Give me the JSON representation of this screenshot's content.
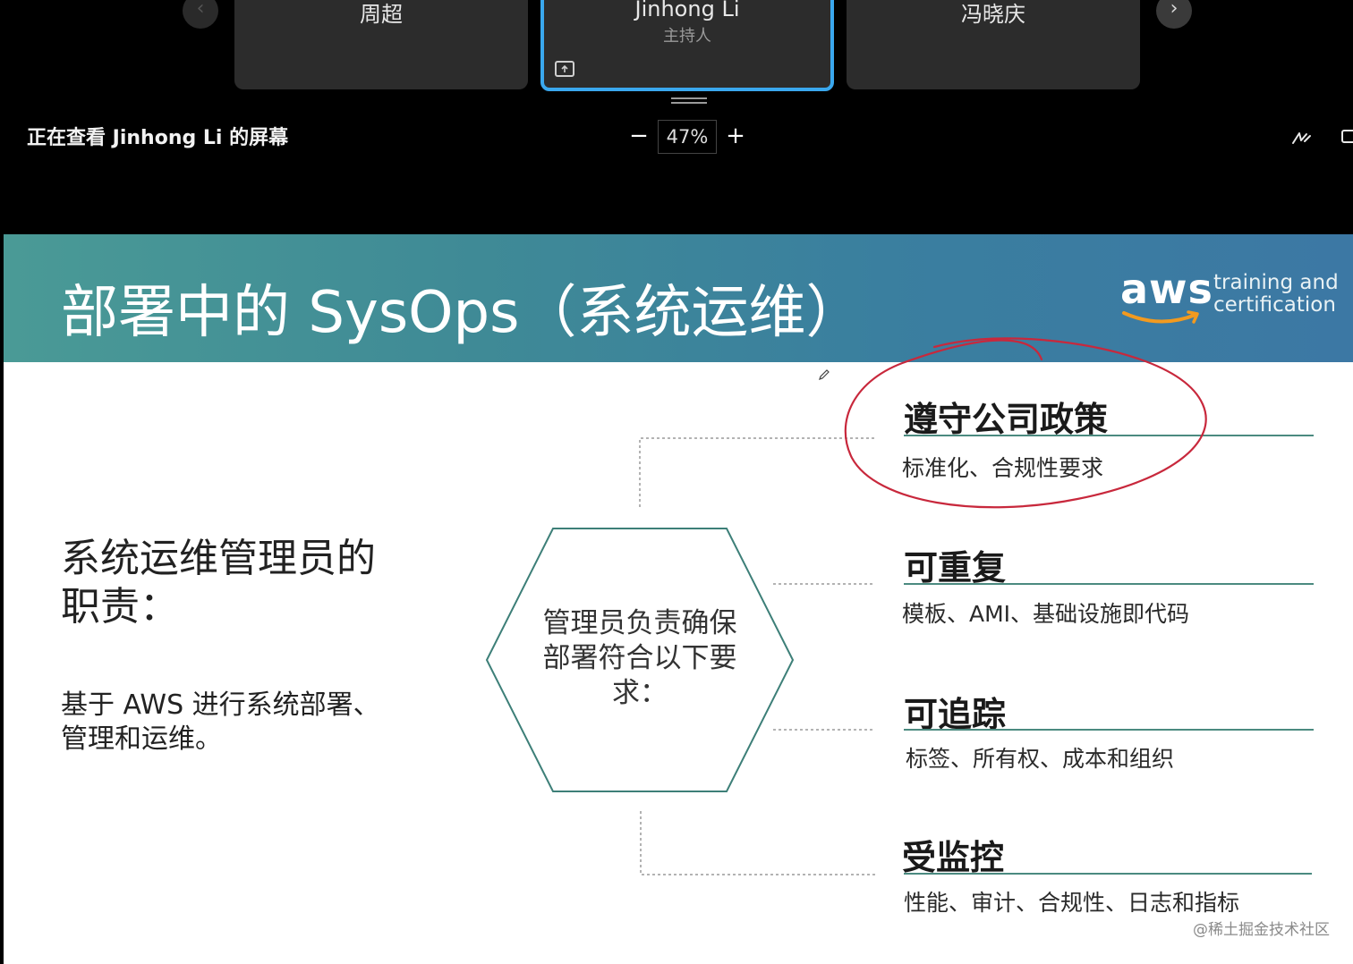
{
  "meeting": {
    "participants": [
      {
        "name": "周超",
        "role": ""
      },
      {
        "name": "Jinhong Li",
        "role": "主持人"
      },
      {
        "name": "冯晓庆",
        "role": ""
      }
    ],
    "prev_icon": "chevron-left-icon",
    "next_icon": "chevron-right-icon",
    "prev_symbol": "‹",
    "next_symbol": "›",
    "viewing_text": "正在查看 Jinhong Li 的屏幕",
    "zoom_minus": "−",
    "zoom_value": "47%",
    "zoom_plus": "+",
    "highlight_color": "#3aa8ee"
  },
  "slide": {
    "title": "部署中的 SysOps（系统运维）",
    "logo": {
      "word": "aws",
      "tagline_line1": "training and",
      "tagline_line2": "certification"
    },
    "left_heading": "系统运维管理员的职责：",
    "left_body": "基于 AWS 进行系统部署、管理和运维。",
    "hexagon_text": "管理员负责确保部署符合以下要求：",
    "items": [
      {
        "title": "遵守公司政策",
        "desc": "标准化、合规性要求",
        "circled": true
      },
      {
        "title": "可重复",
        "desc": "模板、AMI、基础设施即代码"
      },
      {
        "title": "可追踪",
        "desc": "标签、所有权、成本和组织"
      },
      {
        "title": "受监控",
        "desc": "性能、审计、合规性、日志和指标"
      }
    ],
    "accent_color": "#4b8a80",
    "annotation_color": "#c8283c"
  },
  "watermark": "@稀土掘金技术社区"
}
